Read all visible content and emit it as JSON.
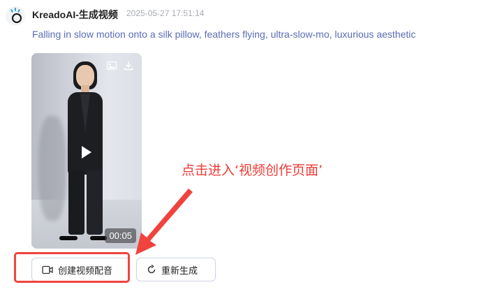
{
  "message": {
    "sender": "KreadoAI-生成视频",
    "timestamp": "2025-05-27 17:51:14",
    "prompt": "Falling in slow motion onto a silk pillow, feathers flying, ultra-slow-mo, luxurious aesthetic"
  },
  "video": {
    "duration": "00:05",
    "icons": [
      "image-icon",
      "download-icon",
      "play-icon"
    ]
  },
  "actions": {
    "create_dubbing": "创建视频配音",
    "regenerate": "重新生成"
  },
  "annotation": {
    "text": "点击进入‘视频创作页面’",
    "color": "#ef3b36"
  },
  "colors": {
    "prompt": "#5b6bb5",
    "timestamp": "#a8abb3",
    "button_border": "#cbd3e3",
    "highlight": "#f0433e"
  }
}
